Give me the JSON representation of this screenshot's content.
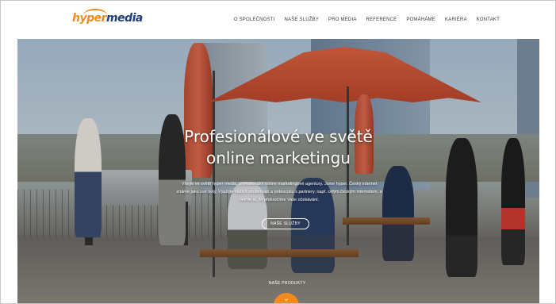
{
  "header": {
    "logo": {
      "part1": "hyper",
      "part2": "media"
    },
    "nav": [
      "O SPOLEČNOSTI",
      "NAŠE SLUŽBY",
      "PRO MEDIA",
      "REFERENCE",
      "POMÁHÁME",
      "KARIÉRA",
      "KONTAKT"
    ]
  },
  "hero": {
    "title": "Profesionálové ve světě\nonline marketingu",
    "text": "Vítejte ve světě hyper media, profesionální online marketingové agentury. Jsme hyper. Český internet známe jako své boty. Využijte našich zkušeností a potenciálu s partnery, např. celým českým internetem, a ověřte si, že překročíme Vaše očekávání.",
    "button_label": "NAŠE SLUŽBY",
    "products_label": "NAŠE PRODUKTY",
    "scroll_icon": "chevron-down-icon"
  },
  "colors": {
    "accent": "#f28a1e",
    "brand_blue": "#1e3d7b",
    "nav_text": "#333a45"
  }
}
